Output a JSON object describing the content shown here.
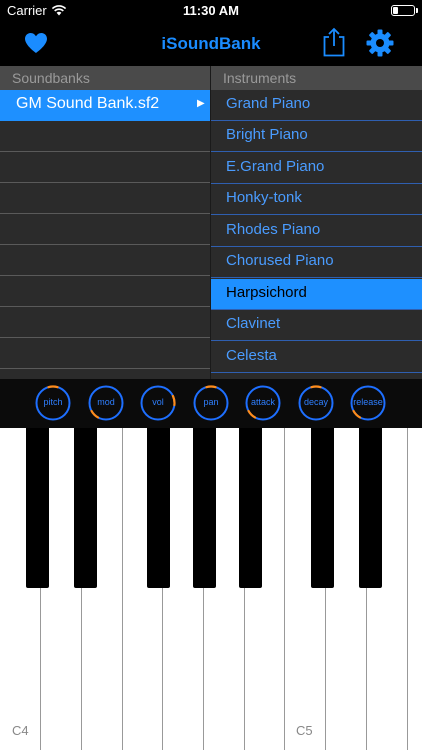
{
  "status_bar": {
    "carrier": "Carrier",
    "time": "11:30 AM",
    "battery_level": 0.25
  },
  "nav": {
    "title": "iSoundBank",
    "icons": [
      "heart-icon",
      "share-icon",
      "gear-icon"
    ],
    "accent_color": "#1a8cff"
  },
  "soundbanks": {
    "header": "Soundbanks",
    "items": [
      {
        "label": "GM Sound Bank.sf2",
        "selected": true,
        "arrow": "▶"
      }
    ]
  },
  "instruments": {
    "header": "Instruments",
    "items": [
      {
        "label": "Grand Piano",
        "selected": false
      },
      {
        "label": "Bright Piano",
        "selected": false
      },
      {
        "label": "E.Grand Piano",
        "selected": false
      },
      {
        "label": "Honky-tonk",
        "selected": false
      },
      {
        "label": "Rhodes Piano",
        "selected": false
      },
      {
        "label": "Chorused Piano",
        "selected": false
      },
      {
        "label": "Harpsichord",
        "selected": true
      },
      {
        "label": "Clavinet",
        "selected": false
      },
      {
        "label": "Celesta",
        "selected": false
      }
    ]
  },
  "knobs": [
    {
      "label": "pitch",
      "value": 0.5
    },
    {
      "label": "mod",
      "value": 0.0
    },
    {
      "label": "vol",
      "value": 0.8
    },
    {
      "label": "pan",
      "value": 0.5
    },
    {
      "label": "attack",
      "value": 0.0
    },
    {
      "label": "decay",
      "value": 0.5
    },
    {
      "label": "release",
      "value": 0.0
    }
  ],
  "keyboard": {
    "labels": {
      "c4": "C4",
      "c5": "C5"
    }
  },
  "colors": {
    "selection": "#1e90ff",
    "knob_ring": "#1e6fff",
    "knob_indicator": "#ff8c1a"
  }
}
